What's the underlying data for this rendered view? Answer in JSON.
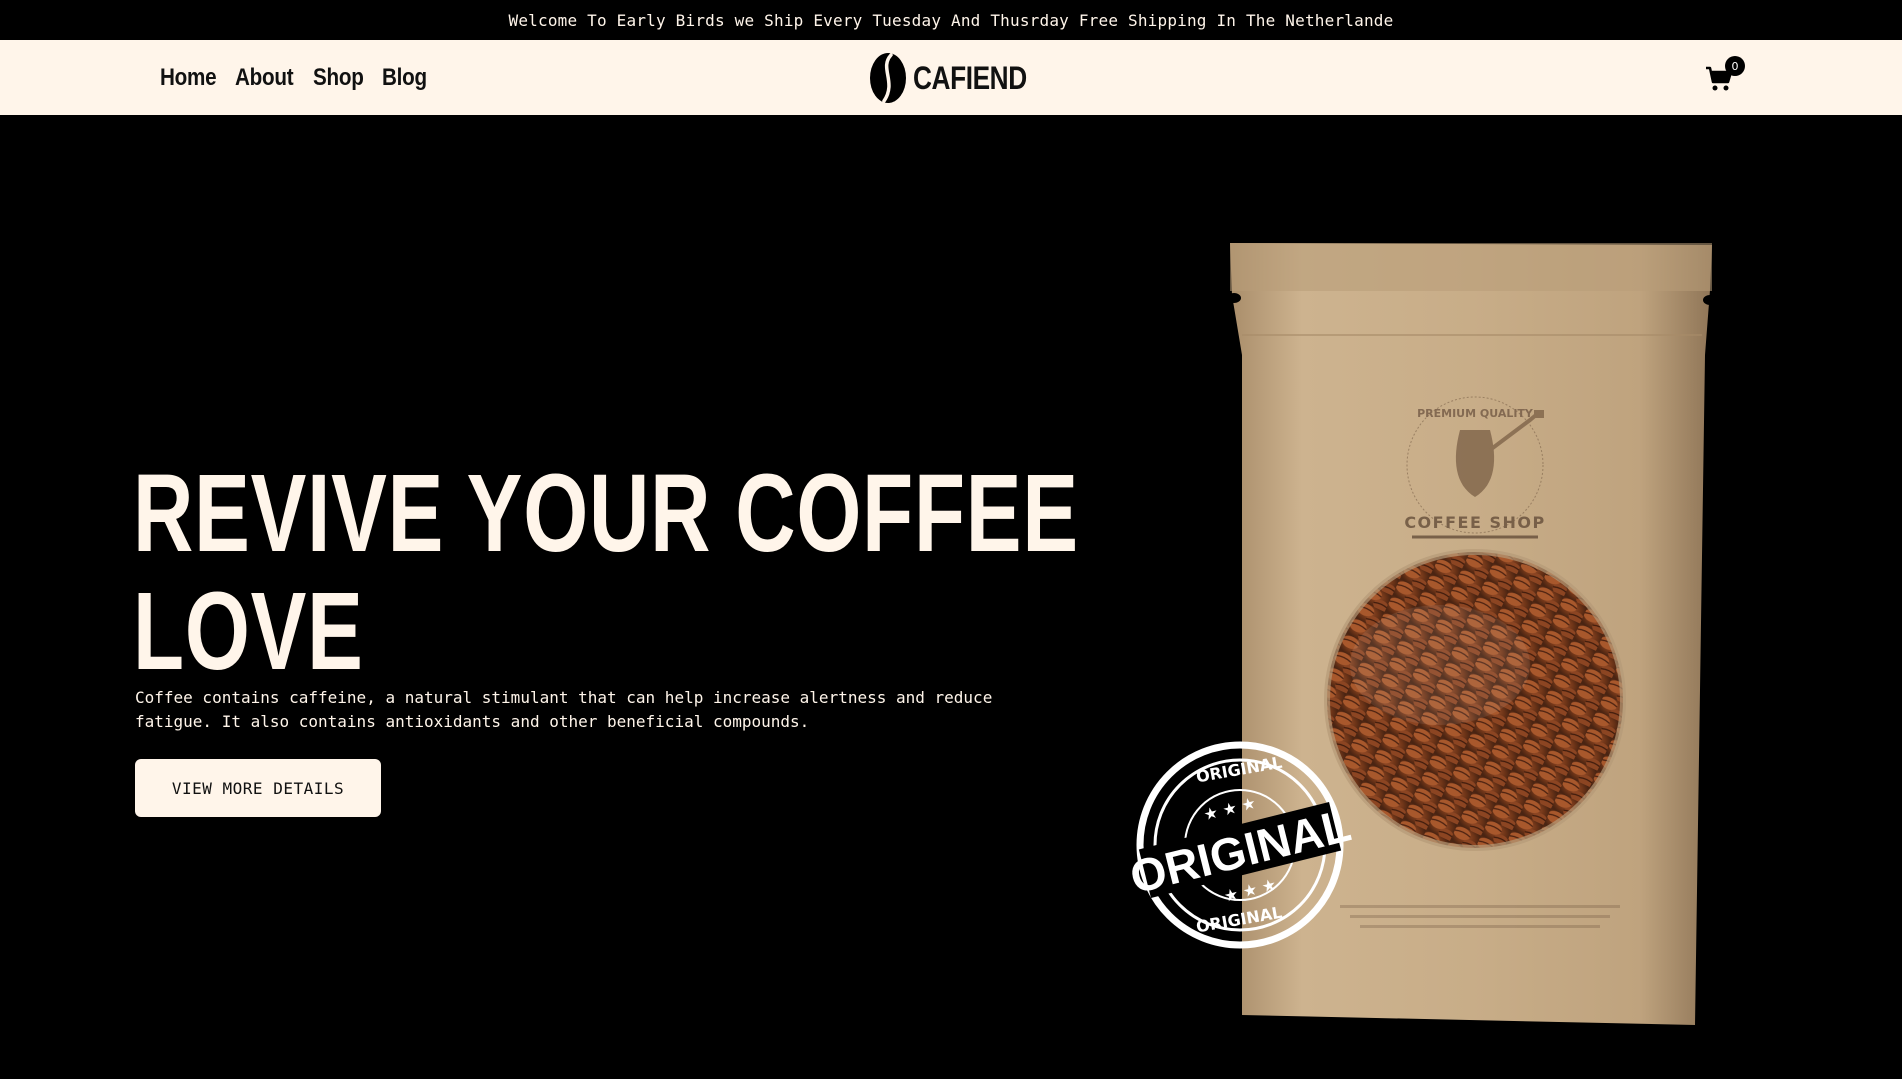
{
  "announcement": "Welcome To Early Birds we Ship Every Tuesday And Thusrday Free Shipping In The Netherlande",
  "nav": {
    "links": [
      "Home",
      "About",
      "Shop",
      "Blog"
    ]
  },
  "logo": {
    "text": "CAFIEND"
  },
  "cart": {
    "count": "0"
  },
  "hero": {
    "title": "REVIVE YOUR COFFEE LOVE",
    "description": "Coffee contains caffeine, a natural stimulant that can help increase alertness and reduce fatigue. It also contains antioxidants and other beneficial compounds.",
    "cta": "VIEW MORE DETAILS"
  },
  "product": {
    "bag_badge_top": "PREMIUM QUALITY",
    "bag_label": "COFFEE SHOP",
    "stamp_text": "ORIGINAL",
    "stamp_ring_top": "ORIGINAL",
    "stamp_ring_bottom": "ORIGINAL"
  },
  "colors": {
    "cream": "#fff5ea",
    "black": "#000000",
    "kraft": "#c9ad87"
  }
}
